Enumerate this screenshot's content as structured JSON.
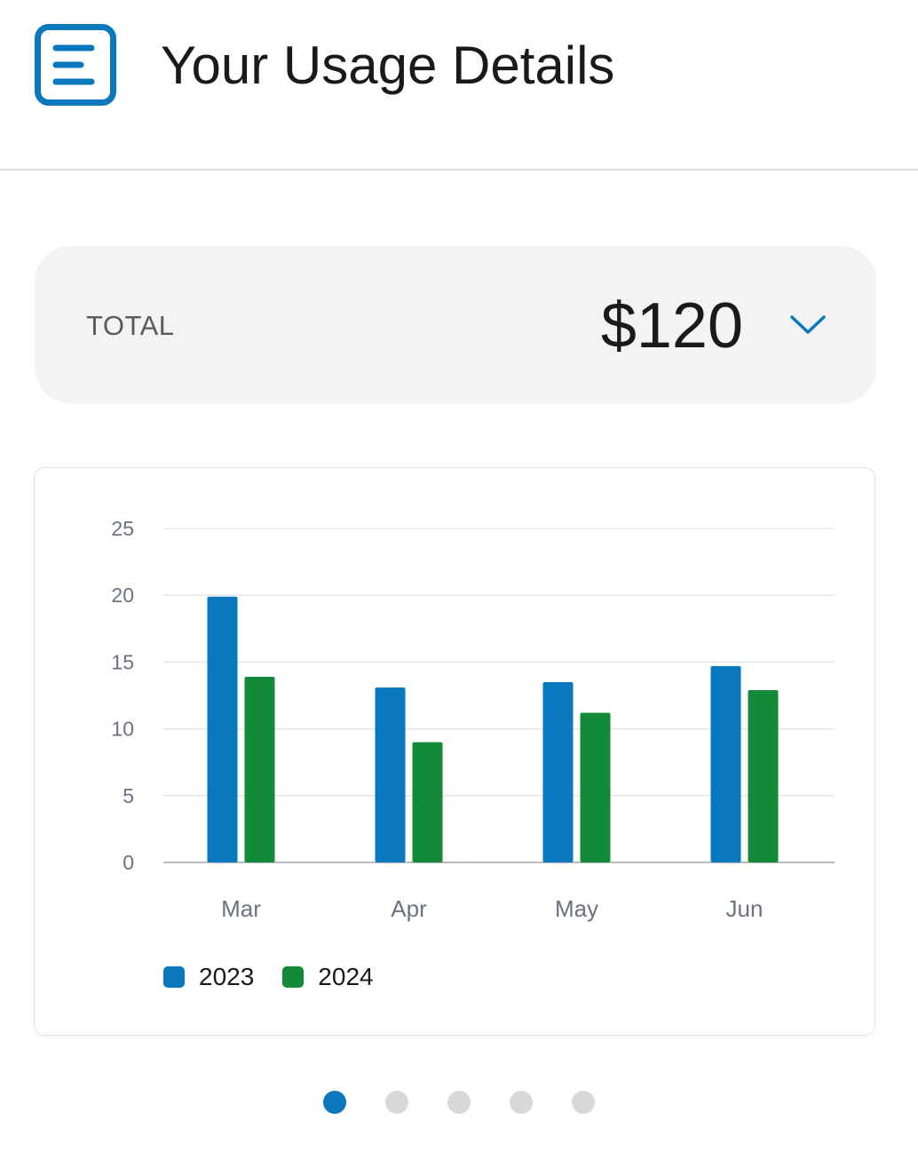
{
  "header": {
    "title": "Your Usage Details",
    "menu_icon": "menu-icon"
  },
  "total": {
    "label": "TOTAL",
    "value": "$120",
    "toggle_icon": "chevron-down-icon"
  },
  "colors": {
    "accent": "#0a78bd",
    "series_2023": "#0a78bd",
    "series_2024": "#128a38",
    "inactive_dot": "#d8d8d8"
  },
  "chart_data": {
    "type": "bar",
    "categories": [
      "Mar",
      "Apr",
      "May",
      "Jun"
    ],
    "series": [
      {
        "name": "2023",
        "values": [
          19.9,
          13.1,
          13.5,
          14.7
        ],
        "color": "#0a78bd"
      },
      {
        "name": "2024",
        "values": [
          13.9,
          9.0,
          11.2,
          12.9
        ],
        "color": "#128a38"
      }
    ],
    "yticks": [
      "0",
      "5",
      "10",
      "15",
      "20",
      "25"
    ],
    "ylim": [
      0,
      25
    ],
    "grid": true,
    "legend_position": "bottom-left"
  },
  "pagination": {
    "count": 5,
    "active_index": 0
  }
}
